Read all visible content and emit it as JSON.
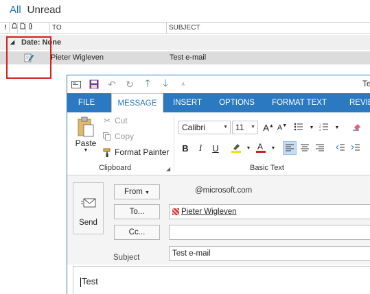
{
  "filters": {
    "all": "All",
    "unread": "Unread"
  },
  "columns": {
    "to": "TO",
    "subject": "SUBJECT"
  },
  "group": {
    "label": "Date: None"
  },
  "message": {
    "to": "Pieter Wigleven",
    "subject": "Test e-mail"
  },
  "compose": {
    "title_fragment": "Te",
    "tabs": [
      "FILE",
      "MESSAGE",
      "INSERT",
      "OPTIONS",
      "FORMAT TEXT",
      "REVIEW"
    ],
    "selected_tab": "MESSAGE",
    "clipboard": {
      "paste": "Paste",
      "cut": "Cut",
      "copy": "Copy",
      "format_painter": "Format Painter",
      "group_label": "Clipboard"
    },
    "basic_text": {
      "font": "Calibri",
      "size": "11",
      "group_label": "Basic Text"
    },
    "send_label": "Send",
    "from_button": "From",
    "from_value": "@microsoft.com",
    "to_button": "To...",
    "to_value": "Pieter Wigleven",
    "cc_button": "Cc...",
    "cc_value": "",
    "subject_label": "Subject",
    "subject_value": "Test e-mail",
    "body_text": "Test"
  },
  "colors": {
    "accent": "#2b79c1",
    "highlight_box": "#d62020",
    "link_blue": "#1f6fb6"
  }
}
